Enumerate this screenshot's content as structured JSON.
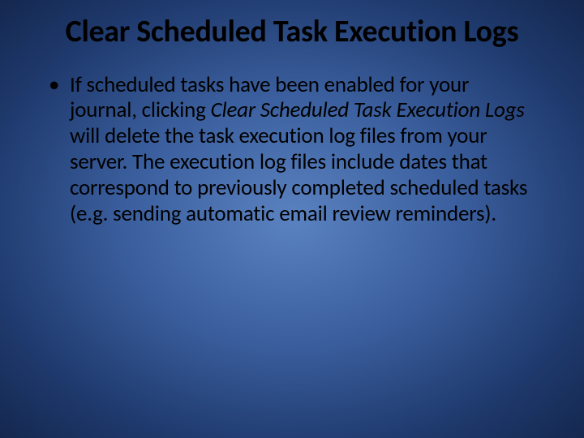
{
  "slide": {
    "title": "Clear Scheduled Task Execution Logs",
    "bullet": {
      "part1": "If scheduled tasks have been enabled for your journal, clicking ",
      "emphasis": "Clear Scheduled Task Execution Logs",
      "part2": " will delete the task execution log files from your server. The execution log files include dates that correspond to previously completed scheduled tasks (e.g. sending automatic email review reminders)."
    }
  }
}
